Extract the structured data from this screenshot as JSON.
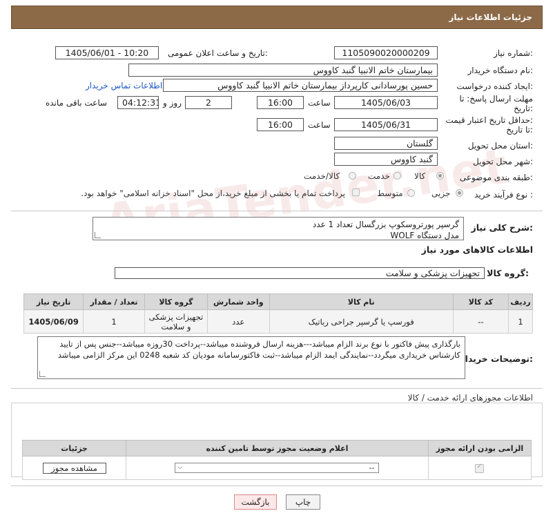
{
  "header": {
    "title": "جزئیات اطلاعات نیاز"
  },
  "form": {
    "need_number": {
      "label": "شماره نیاز:",
      "value": "1105090020000209"
    },
    "announce_date": {
      "label": "تاریخ و ساعت اعلان عمومی:",
      "value": "1405/06/01 - 10:20"
    },
    "buyer_org": {
      "label": "نام دستگاه خریدار:",
      "value": "بیمارستان خاتم الانبیا گنبد کاووس"
    },
    "requester": {
      "label": "ایجاد کننده درخواست:",
      "value": "حسین پورسادانی کارپرداز بیمارستان خاتم الانبیا گنبد کاووس",
      "contact_link": "اطلاعات تماس خریدار"
    },
    "deadline": {
      "label_line1": "مهلت ارسال پاسخ: تا",
      "label_line2": "تاریخ:",
      "date": "1405/06/03",
      "time_label": "ساعت",
      "time": "16:00",
      "days": "2",
      "days_label": "روز و",
      "remaining": "04:12:31",
      "remaining_label": "ساعت باقی مانده"
    },
    "price_validity": {
      "label_line1": "حداقل تاریخ اعتبار قیمت:",
      "label_line2": "تا تاریخ:",
      "date": "1405/06/31",
      "time_label": "ساعت",
      "time": "16:00"
    },
    "province": {
      "label": "استان محل تحویل:",
      "value": "گلستان"
    },
    "city": {
      "label": "شهر محل تحویل:",
      "value": "گنبد کاووس"
    },
    "category": {
      "label": "طبقه بندی موضوعی:",
      "options": [
        "کالا",
        "خدمت",
        "کالا/خدمت"
      ],
      "selected": "کالا"
    },
    "purchase_type": {
      "label": "نوع فرآیند خرید :",
      "options": [
        "جزیی",
        "متوسط"
      ],
      "selected": "جزیی",
      "payment_note": "پرداخت تمام یا بخشی از مبلغ خرید،از محل \"اسناد خزانه اسلامی\" خواهد بود."
    }
  },
  "description": {
    "label": "شرح کلی نیاز:",
    "line1": "گرسپر پورتروسکوپ بزرگسال تعداد 1 عدد",
    "line2": "مدل دستگاه WOLF"
  },
  "goods_section": {
    "title": "اطلاعات کالاهای مورد نیاز"
  },
  "goods_group": {
    "label": "گروه کالا:",
    "value": "تجهیزات پزشکی و سلامت"
  },
  "items_table": {
    "headers": [
      "ردیف",
      "کد کالا",
      "نام کالا",
      "واحد شمارش",
      "گروه کالا",
      "تعداد / مقدار",
      "تاریخ نیاز"
    ],
    "rows": [
      [
        "1",
        "--",
        "فورسپ یا گرسپر جراحی رباتیک",
        "عدد",
        "تجهیزات پزشکی و سلامت",
        "1",
        "1405/06/09"
      ]
    ]
  },
  "buyer_notes": {
    "label": "توضیحات خریدار:",
    "line1": "بارگذاری پیش فاکتور با نوع برند الزام میباشد---هزینه ارسال فروشنده میباشد--پرداخت 30روزه میباشد--جنس پس از تایید",
    "line2": "کارشناس خریداری میگردد--نمایندگی ایمد الزام میباشد--ثبت فاکتورسامانه مودیان کد شعبه 0248 این مرکز الزامی میباشد"
  },
  "permits": {
    "title": "اطلاعات مجوزهای ارائه خدمت / کالا",
    "headers": [
      "الزامی بودن ارائه مجوز",
      "اعلام وضعیت مجوز توسط تامین کننده",
      "جزئیات"
    ],
    "select_value": "--",
    "view_button": "مشاهده مجوز"
  },
  "footer": {
    "print": "چاپ",
    "back": "بازگشت"
  },
  "watermark": "AriaTender.net"
}
